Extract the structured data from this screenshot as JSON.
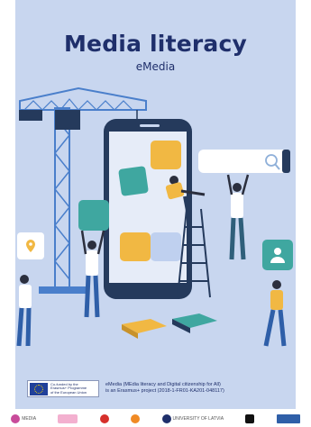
{
  "cover": {
    "title": "Media literacy",
    "subtitle": "eMedia"
  },
  "eu_logo": {
    "line1": "Co-funded by the",
    "line2": "Erasmus+ Programme",
    "line3": "of the European Union"
  },
  "credit": {
    "line1": "eMedia (MEdia literacy and Digital citizenship for All)",
    "line2": "is an Erasmus+ project (2018-1-FR01-KA201-048117)"
  },
  "footer": {
    "logo1": "MEDIA",
    "logo2": "UNIVERSITY OF LATVIA"
  },
  "icons": [
    "location-pin-icon",
    "search-icon",
    "user-icon"
  ],
  "colors": {
    "background": "#c8d6ef",
    "title": "#1f2f6b",
    "crane": "#4a7fcb",
    "phone": "#2b4a6f",
    "teal": "#3fa7a0",
    "yellow": "#f1b843"
  }
}
